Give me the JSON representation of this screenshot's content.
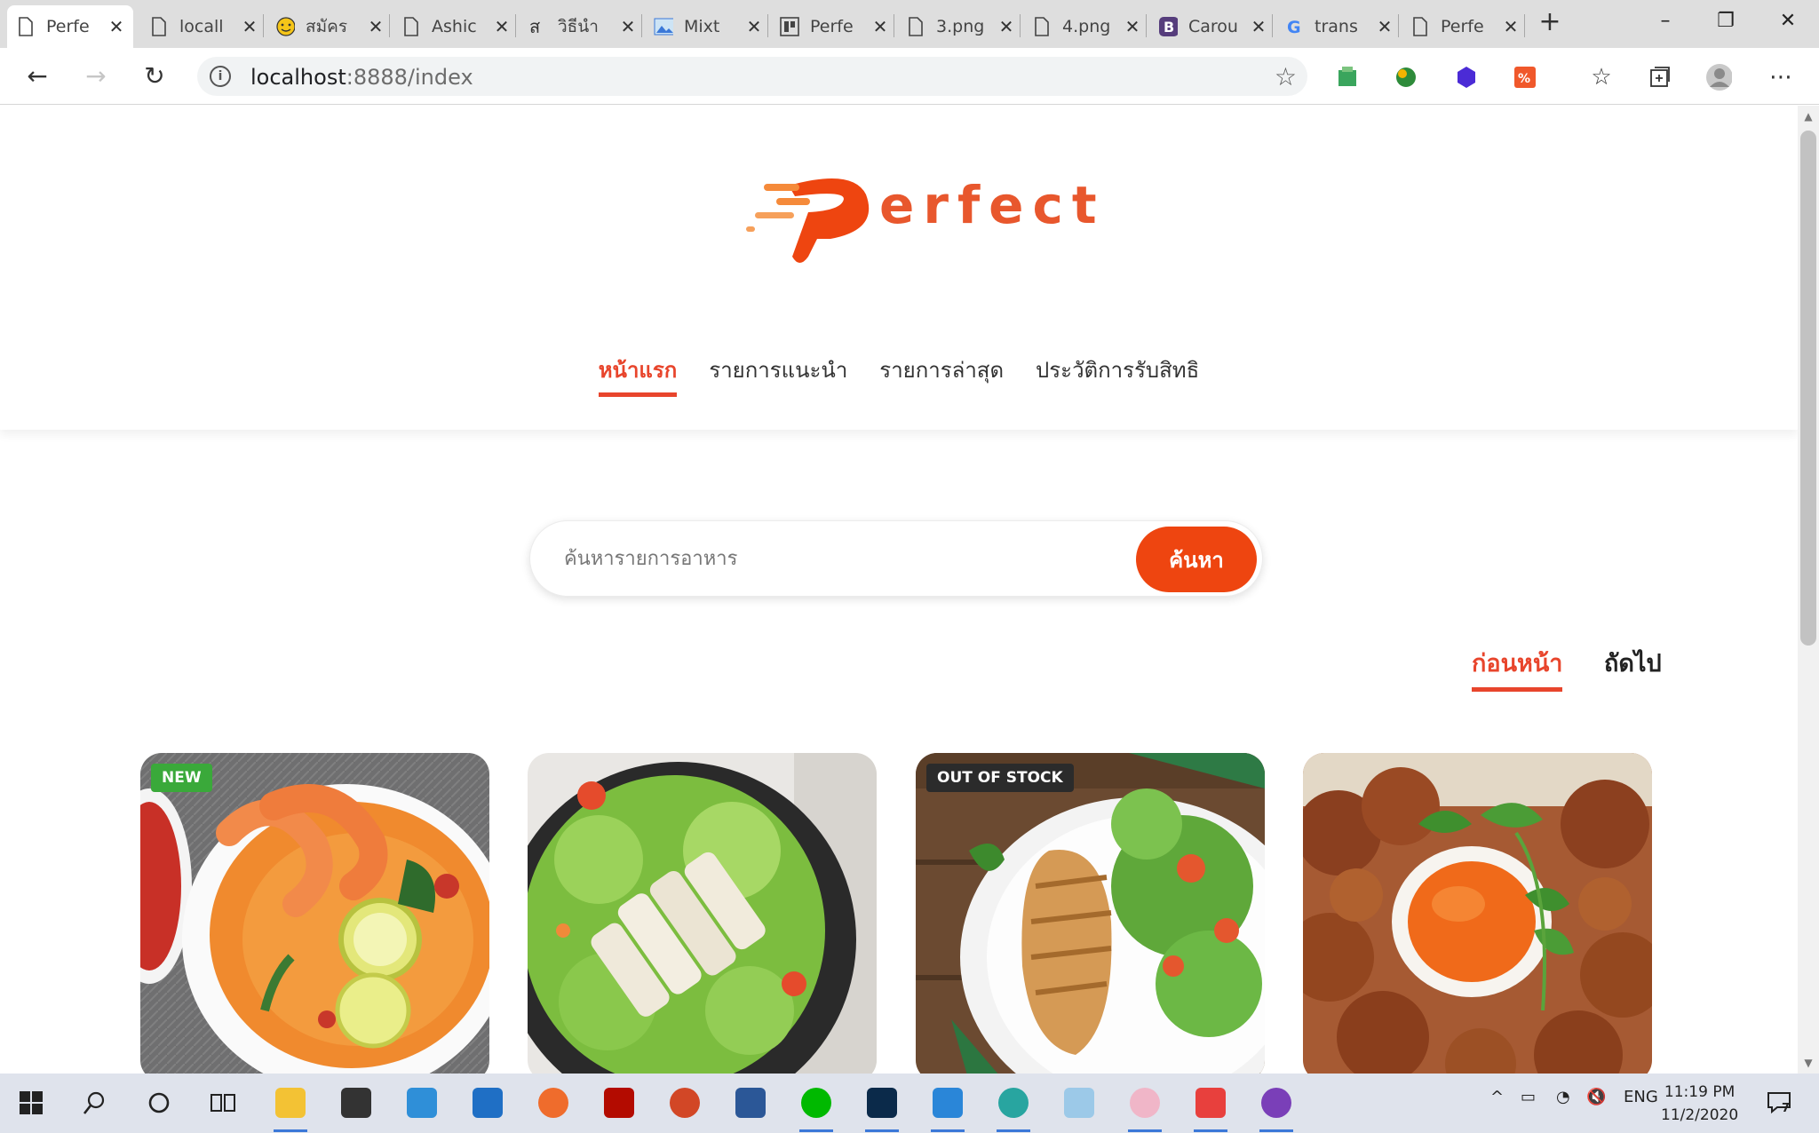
{
  "browser": {
    "tabs": [
      {
        "title": "Perfe",
        "icon": "page-icon",
        "active": true
      },
      {
        "title": "locall",
        "icon": "page-icon"
      },
      {
        "title": "สมัคร",
        "icon": "emoji-icon"
      },
      {
        "title": "Ashic",
        "icon": "page-icon"
      },
      {
        "title": "วิธีนำ",
        "icon": "thai-letter-icon"
      },
      {
        "title": "Mixt",
        "icon": "image-icon"
      },
      {
        "title": "Perfe",
        "icon": "layout-icon"
      },
      {
        "title": "3.png",
        "icon": "page-icon"
      },
      {
        "title": "4.png",
        "icon": "page-icon"
      },
      {
        "title": "Carou",
        "icon": "bootstrap-icon"
      },
      {
        "title": "trans",
        "icon": "google-icon"
      },
      {
        "title": "Perfe",
        "icon": "page-icon"
      }
    ],
    "url_host": "localhost",
    "url_rest": ":8888/index"
  },
  "site": {
    "logo_text": "erfect",
    "nav": [
      "หน้าแรก",
      "รายการแนะนำ",
      "รายการล่าสุด",
      "ประวัติการรับสิทธิ"
    ],
    "search_placeholder": "ค้นหารายการอาหาร",
    "search_button": "ค้นหา",
    "pager_prev": "ก่อนหน้า",
    "pager_next": "ถัดไป",
    "cards": [
      {
        "badge": "NEW",
        "image": "tom-yum-soup"
      },
      {
        "badge": "",
        "image": "chicken-salad"
      },
      {
        "badge": "OUT OF STOCK",
        "image": "grilled-chicken-salad"
      },
      {
        "badge": "",
        "image": "fried-chicken-with-sauce"
      }
    ]
  },
  "taskbar": {
    "language": "ENG",
    "time": "11:19 PM",
    "date": "11/2/2020",
    "notification_count": "7"
  },
  "colors": {
    "brand_orange": "#ee4510",
    "nav_active": "#e8452c",
    "badge_new": "#3aa93a",
    "badge_oos": "#2b2b2b"
  }
}
